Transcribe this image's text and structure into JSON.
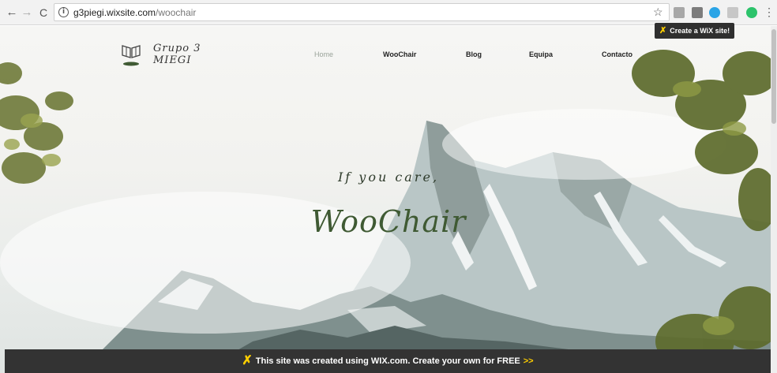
{
  "browser": {
    "url_host": "g3piegi.wixsite.com",
    "url_path": "/woochair"
  },
  "site": {
    "logo_line1": "Grupo 3",
    "logo_line2": "MIEGI",
    "nav": [
      "Home",
      "WooChair",
      "Blog",
      "Equipa",
      "Contacto"
    ],
    "tagline": "If you care,",
    "title": "WooChair"
  },
  "wix": {
    "badge_label": "Create a WiX site!",
    "banner_text": "This site was created using WIX.com. Create your own for FREE",
    "banner_arrows": ">>"
  },
  "colors": {
    "title_green": "#3f5a33",
    "wix_yellow": "#ffcf00",
    "banner_bg": "#333333"
  }
}
